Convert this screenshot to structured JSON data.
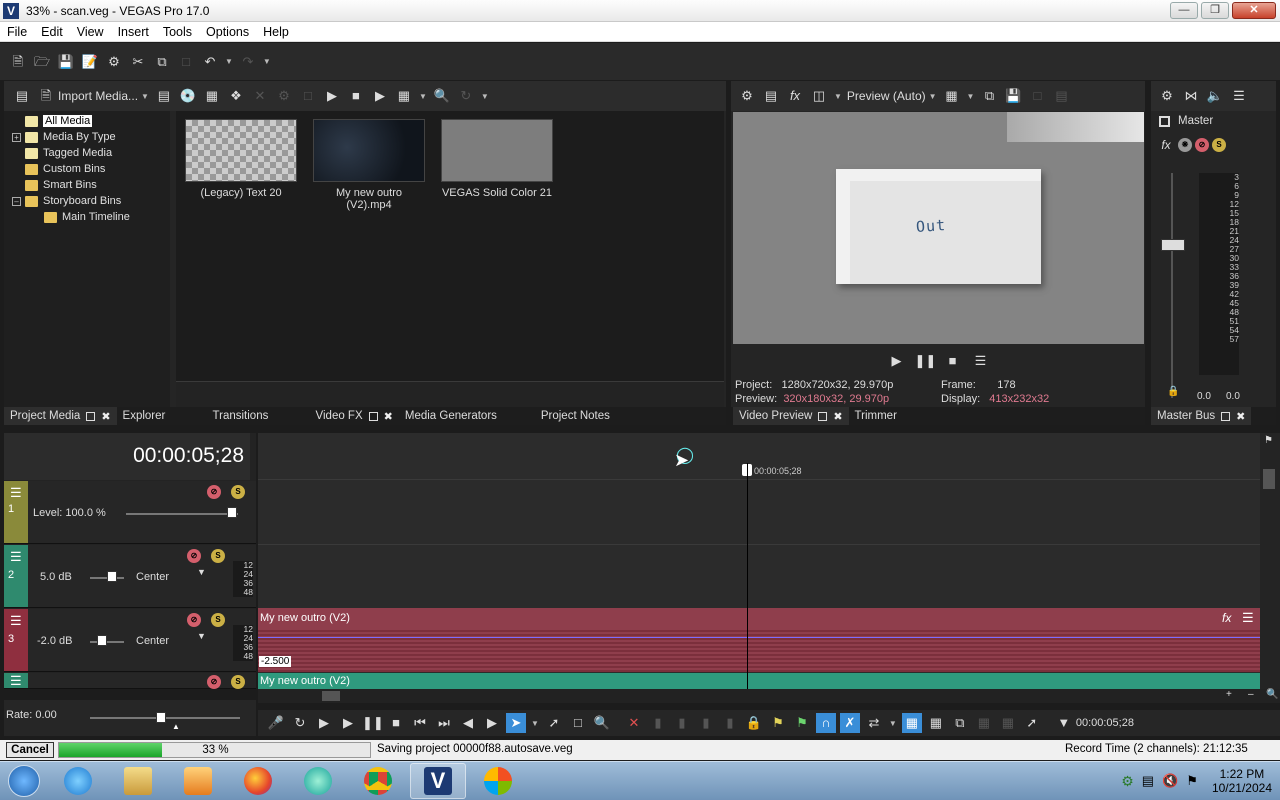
{
  "window": {
    "title": "33% - scan.veg - VEGAS Pro 17.0",
    "app_icon": "V"
  },
  "menu": [
    "File",
    "Edit",
    "View",
    "Insert",
    "Tools",
    "Options",
    "Help"
  ],
  "media_panel": {
    "import_label": "Import Media...",
    "tree": [
      {
        "label": "All Media",
        "selected": true
      },
      {
        "label": "Media By Type"
      },
      {
        "label": "Tagged Media"
      },
      {
        "label": "Custom Bins"
      },
      {
        "label": "Smart Bins"
      },
      {
        "label": "Storyboard Bins"
      },
      {
        "label": "Main Timeline"
      }
    ],
    "thumbnails": [
      {
        "label": "(Legacy) Text 20"
      },
      {
        "label": "My new outro (V2).mp4"
      },
      {
        "label": "VEGAS Solid Color 21"
      }
    ],
    "tabs": [
      "Project Media",
      "Explorer",
      "Transitions",
      "Video FX",
      "Media Generators",
      "Project Notes"
    ]
  },
  "preview_panel": {
    "mode_label": "Preview (Auto)",
    "frame_text": "Out",
    "project_label": "Project:",
    "project_value": "1280x720x32, 29.970p",
    "preview_label": "Preview:",
    "preview_value": "320x180x32, 29.970p",
    "frame_label": "Frame:",
    "frame_value": "178",
    "display_label": "Display:",
    "display_value": "413x232x32",
    "tabs": [
      "Video Preview",
      "Trimmer"
    ]
  },
  "master_bus": {
    "title": "Master",
    "scale": [
      "3",
      "6",
      "9",
      "12",
      "15",
      "18",
      "21",
      "24",
      "27",
      "30",
      "33",
      "36",
      "39",
      "42",
      "45",
      "48",
      "51",
      "54",
      "57"
    ],
    "left_value": "0.0",
    "right_value": "0.0",
    "tab": "Master Bus"
  },
  "timeline": {
    "timecode": "00:00:05;28",
    "cursor_label": "00:00:05;28",
    "tracks": [
      {
        "number": "1",
        "level": "Level: 100.0 %",
        "color": "#8a8a3a"
      },
      {
        "number": "2",
        "volume": "5.0 dB",
        "pan": "Center",
        "color": "#2f8a6e"
      },
      {
        "number": "3",
        "volume": "-2.0 dB",
        "pan": "Center",
        "color": "#8f2f3f"
      }
    ],
    "db_scale": [
      "12",
      "24",
      "36",
      "48"
    ],
    "events": [
      {
        "name": "My new outro (V2)",
        "value_tag": "-2.500"
      },
      {
        "name": "My new outro (V2)"
      }
    ],
    "rate": "Rate: 0.00",
    "transport_time": "00:00:05;28"
  },
  "status": {
    "cancel": "Cancel",
    "progress_text": "33 %",
    "progress": 0.33,
    "message": "Saving project 00000f88.autosave.veg",
    "record_time": "Record Time (2 channels): 21:12:35"
  },
  "taskbar": {
    "time": "1:22 PM",
    "date": "10/21/2024",
    "apps": [
      "ie-icon",
      "explorer-icon",
      "media-player-icon",
      "firefox-icon",
      "app-icon",
      "chrome-icon",
      "vegas-icon",
      "windows-app-icon"
    ]
  }
}
